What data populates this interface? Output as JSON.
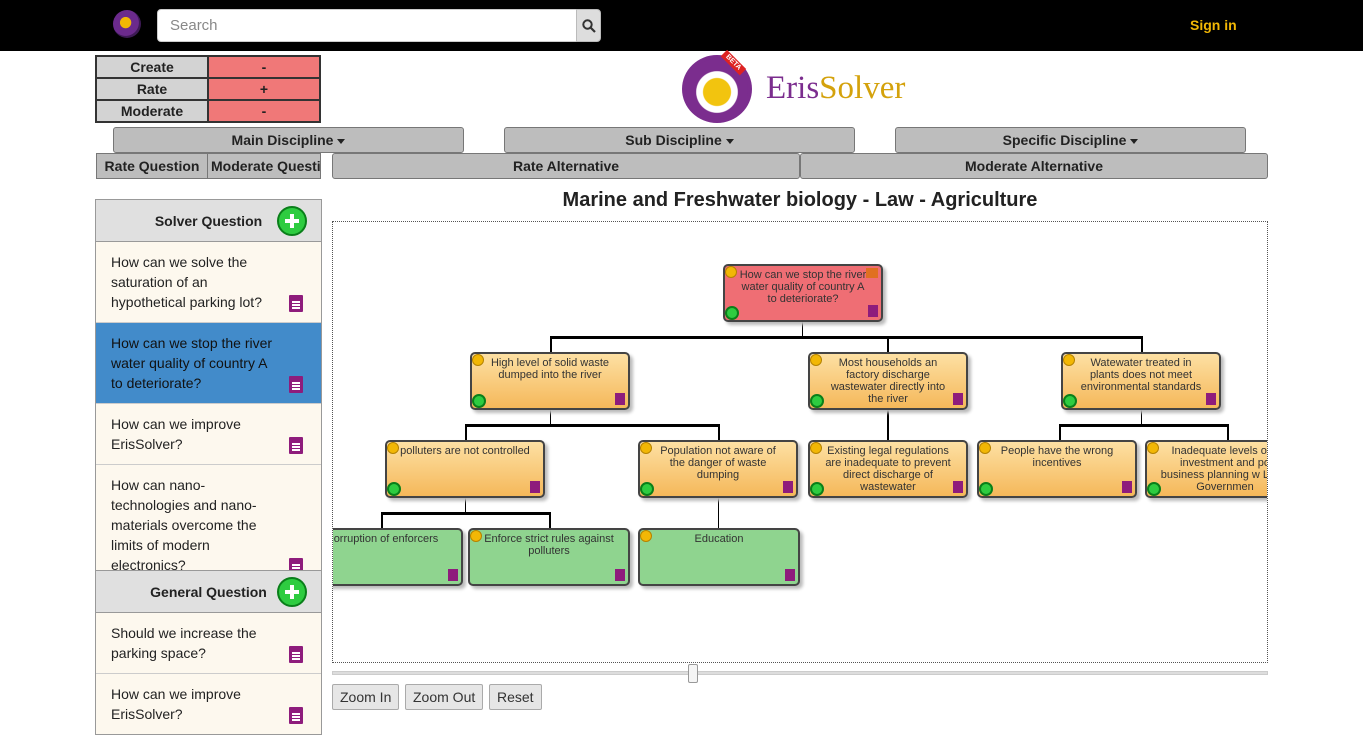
{
  "header": {
    "search_placeholder": "Search",
    "signin_label": "Sign in"
  },
  "status": [
    {
      "label": "Create",
      "value": "-"
    },
    {
      "label": "Rate",
      "value": "+"
    },
    {
      "label": "Moderate",
      "value": "-"
    }
  ],
  "brand": {
    "name_part1": "Eris",
    "name_part2": "Solver",
    "badge": "BETA"
  },
  "disciplines": {
    "main": "Main Discipline",
    "sub": "Sub Discipline",
    "specific": "Specific Discipline"
  },
  "tabs": {
    "rate_question": "Rate Question",
    "moderate_question": "Moderate Question",
    "rate_alternative": "Rate Alternative",
    "moderate_alternative": "Moderate Alternative"
  },
  "solver_panel": {
    "title": "Solver Question",
    "items": [
      "How can we solve the saturation of an hypothetical parking lot?",
      "How can we stop the river water quality of country A to deteriorate?",
      "How can we improve ErisSolver?",
      "How can nano-technologies and nano-materials overcome the limits of modern electronics?"
    ]
  },
  "general_panel": {
    "title": "General Question",
    "items": [
      "Should we increase the parking space?",
      "How can we improve ErisSolver?"
    ]
  },
  "main_title": "Marine and Freshwater biology - Law - Agriculture",
  "tree": {
    "root": "How can we stop the river water quality of country A to deteriorate?",
    "level1": [
      "High level of solid waste dumped into the river",
      "Most households an factory discharge wastewater directly into the river",
      "Watewater treated in plants does not meet environmental standards"
    ],
    "level2": [
      "polluters are not controlled",
      "Population not aware of the danger of waste dumping",
      "Existing legal regulations are inadequate to prevent direct discharge of wastewater",
      "People have the wrong incentives",
      "Inadequate levels of c investment and po business planning w Local Governmen"
    ],
    "solutions": [
      "Corruption of enforcers",
      "Enforce strict rules against polluters",
      "Education"
    ]
  },
  "zoom": {
    "zoom_in": "Zoom In",
    "zoom_out": "Zoom Out",
    "reset": "Reset"
  }
}
